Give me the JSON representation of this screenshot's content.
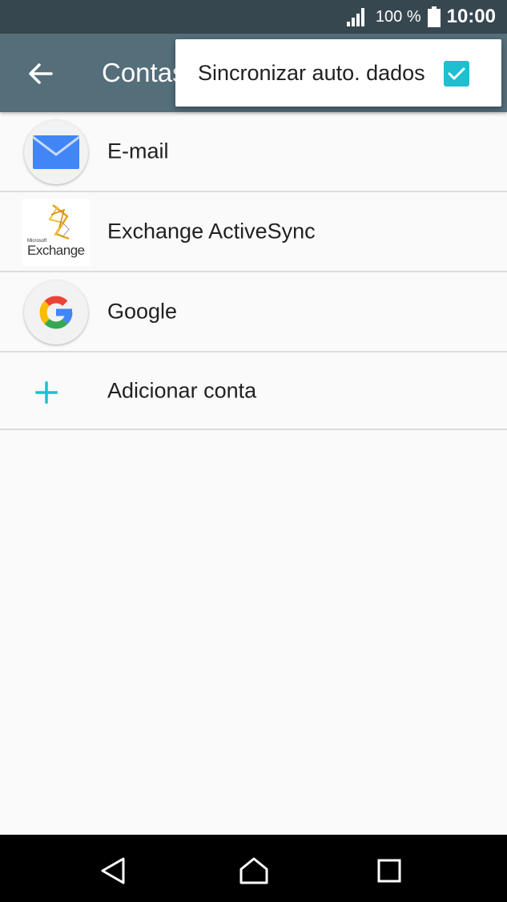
{
  "status_bar": {
    "battery_percent": "100 %",
    "time": "10:00",
    "icons": [
      "signal-icon",
      "battery-icon"
    ]
  },
  "app_bar": {
    "title": "Contas",
    "back_icon": "arrow-back-icon"
  },
  "menu": {
    "sync_label": "Sincronizar auto. dados",
    "sync_checked": true,
    "accent_color": "#1fbfcf"
  },
  "accounts": {
    "items": [
      {
        "label": "E-mail",
        "icon": "email-icon"
      },
      {
        "label": "Exchange ActiveSync",
        "icon": "exchange-logo"
      },
      {
        "label": "Google",
        "icon": "google-icon"
      }
    ],
    "add_label": "Adicionar conta",
    "add_icon": "plus-icon"
  },
  "exchange_logo_text": {
    "brand": "Microsoft",
    "product": "Exchange"
  },
  "nav_bar": {
    "icons": [
      "back-nav-icon",
      "home-nav-icon",
      "recents-nav-icon"
    ]
  },
  "colors": {
    "status_bar": "#37474f",
    "app_bar": "#546e7a",
    "background": "#fafafa"
  }
}
